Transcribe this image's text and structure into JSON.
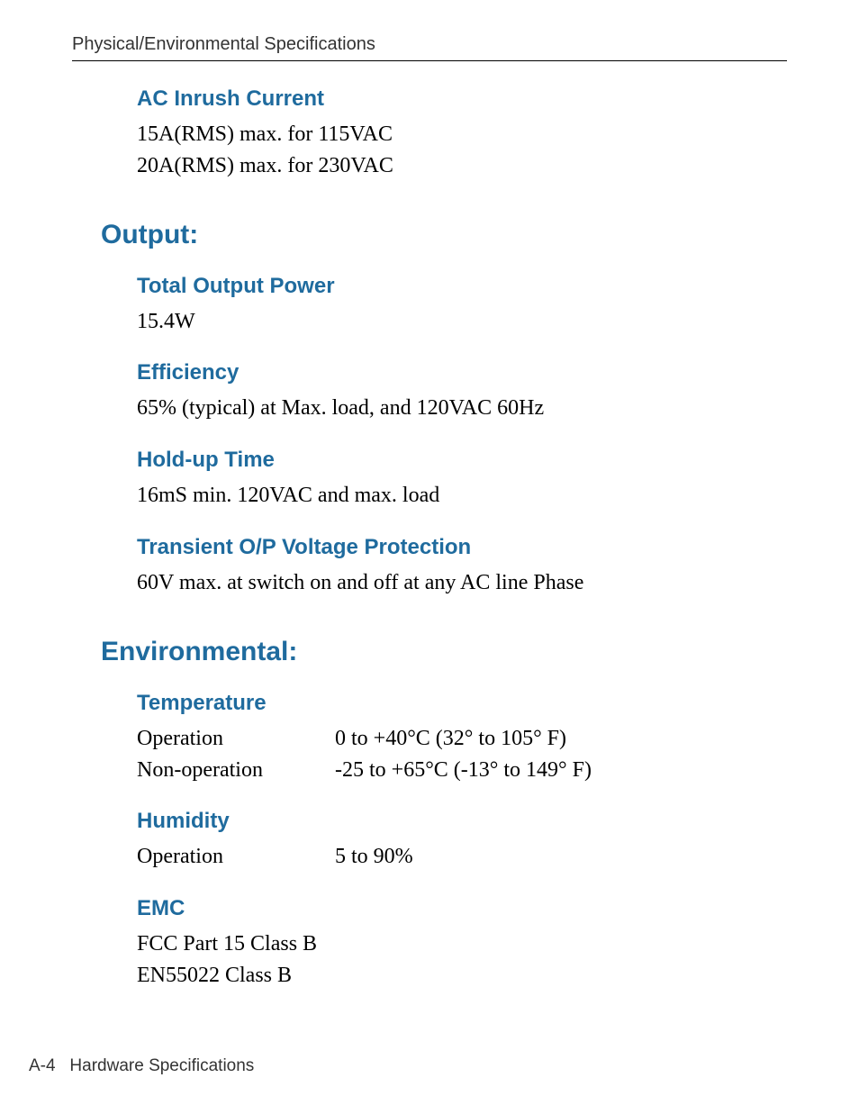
{
  "header": "Physical/Environmental Specifications",
  "sections": {
    "ac_inrush": {
      "title": "AC Inrush Current",
      "lines": [
        "15A(RMS) max. for 115VAC",
        "20A(RMS) max. for 230VAC"
      ]
    },
    "output": {
      "title": "Output:",
      "total_power": {
        "title": "Total Output Power",
        "value": "15.4W"
      },
      "efficiency": {
        "title": "Efficiency",
        "value": "65% (typical) at Max. load, and 120VAC 60Hz"
      },
      "holdup": {
        "title": "Hold-up Time",
        "value": "16mS min. 120VAC and max. load"
      },
      "transient": {
        "title": "Transient O/P Voltage Protection",
        "value": "60V max. at switch on and off at any AC line Phase"
      }
    },
    "environmental": {
      "title": "Environmental:",
      "temperature": {
        "title": "Temperature",
        "operation_label": "Operation",
        "operation_value": "0 to +40°C (32° to 105° F)",
        "nonop_label": "Non-operation",
        "nonop_value": "-25 to +65°C (-13° to 149° F)"
      },
      "humidity": {
        "title": "Humidity",
        "operation_label": "Operation",
        "operation_value": "5 to 90%"
      },
      "emc": {
        "title": "EMC",
        "lines": [
          "FCC Part 15 Class B",
          "EN55022 Class B"
        ]
      }
    }
  },
  "footer": {
    "page": "A-4",
    "label": "Hardware Specifications"
  }
}
